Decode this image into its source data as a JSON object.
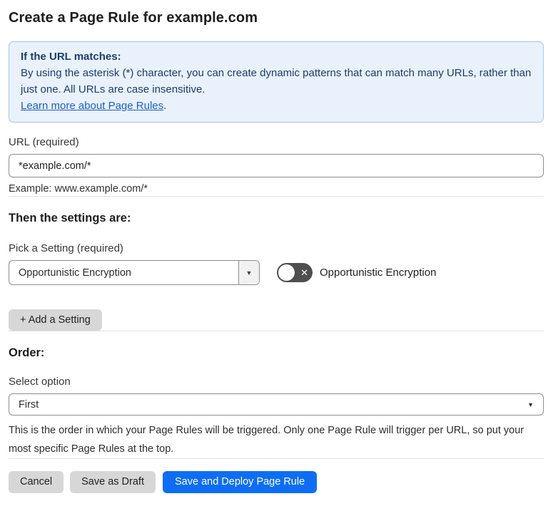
{
  "page": {
    "title": "Create a Page Rule for example.com"
  },
  "info_box": {
    "heading": "If the URL matches:",
    "body": "By using the asterisk (*) character, you can create dynamic patterns that can match many URLs, rather than just one. All URLs are case insensitive.",
    "link_label": "Learn more about Page Rules",
    "link_suffix": "."
  },
  "url_field": {
    "label": "URL (required)",
    "value": "*example.com/*",
    "helper": "Example: www.example.com/*"
  },
  "settings_section": {
    "heading": "Then the settings are:",
    "picker_label": "Pick a Setting (required)",
    "picker_value": "Opportunistic Encryption",
    "toggle_label": "Opportunistic Encryption",
    "toggle_state": "off",
    "add_setting_label": "+ Add a Setting"
  },
  "order_section": {
    "heading": "Order:",
    "select_label": "Select option",
    "select_value": "First",
    "helper": "This is the order in which your Page Rules will be triggered. Only one Page Rule will trigger per URL, so put your most specific Page Rules at the top."
  },
  "footer": {
    "cancel_label": "Cancel",
    "save_draft_label": "Save as Draft",
    "deploy_label": "Save and Deploy Page Rule"
  },
  "icons": {
    "dropdown_arrow": "▼",
    "toggle_x": "✕"
  },
  "colors": {
    "info_bg": "#e9f2fc",
    "info_border": "#a2c5e8",
    "info_text": "#1e3c6e",
    "link": "#1a5ed0",
    "primary_button": "#0d6ef5",
    "toggle_off": "#4f4f4f",
    "gray_button": "#d7d7d7"
  }
}
